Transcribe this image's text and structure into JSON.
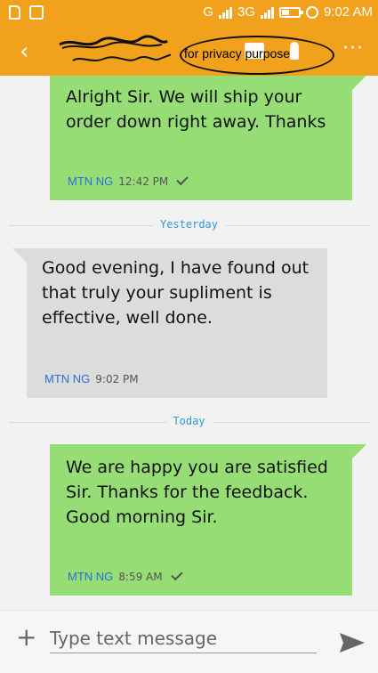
{
  "status_bar": {
    "network_g": "G",
    "network_3g": "3G",
    "time": "9:02 AM"
  },
  "toolbar": {
    "annotation": "for privacy purpose",
    "more_label": "···"
  },
  "messages": [
    {
      "text": "Alright Sir. We will ship your order down right away. Thanks",
      "sender": "MTN NG",
      "time": "12:42 PM"
    },
    {
      "text": "Good evening, I have found out that truly your supliment is effective, well done.",
      "sender": "MTN NG",
      "time": "9:02 PM"
    },
    {
      "text": "We are happy you are satisfied Sir. Thanks for the feedback. Good morning Sir.",
      "sender": "MTN NG",
      "time": "8:59 AM"
    }
  ],
  "separators": {
    "yesterday": "Yesterday",
    "today": "Today"
  },
  "composer": {
    "placeholder": "Type text message"
  },
  "colors": {
    "toolbar": "#f2a11c",
    "sent_bubble": "#95dd74",
    "received_bubble": "#dcdcdc",
    "sender": "#2e6fd6",
    "date_separator": "#2e9bd6"
  },
  "icons": [
    "sim-icon",
    "bbm-icon",
    "signal-icon",
    "battery-icon",
    "alarm-icon",
    "back-icon",
    "contact-icon",
    "call-icon",
    "more-icon",
    "tick-icon",
    "add-icon",
    "send-icon"
  ]
}
